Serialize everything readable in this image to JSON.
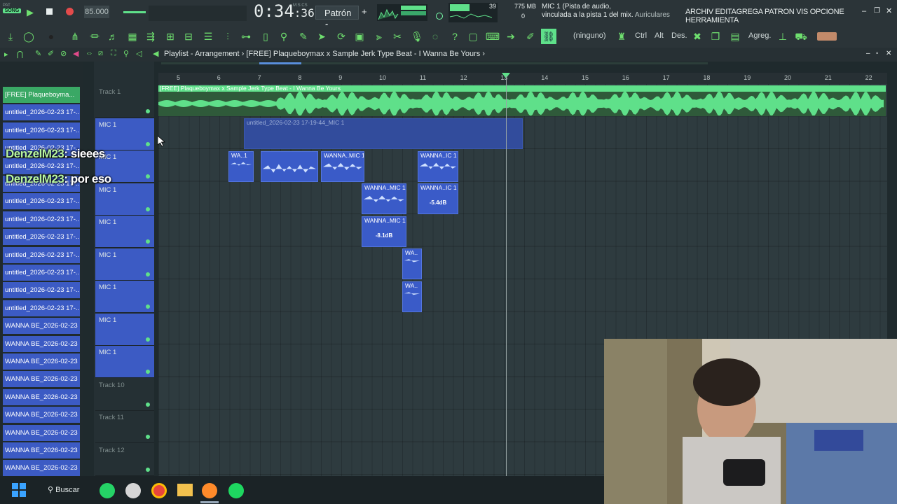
{
  "topbar": {
    "song_label": "SONG",
    "bpm": "85.000",
    "time_main": "0:34",
    "time_sub": ":36",
    "time_unit": "M:S:CS",
    "pattern": "Patrón 1",
    "cpu_value": "39",
    "memory": "775 MB",
    "voice_count": "0",
    "hint_line1": "MIC 1 (Pista de audio,",
    "hint_line2": "vinculada a la pista 1 del mix.",
    "hint_line3": "Auriculares",
    "menu": "ARCHIV EDITAGREGA PATRON VIS OPCIONE HERRAMIENTA"
  },
  "toolbar2": {
    "none_label": "(ninguno)",
    "ctrl": "Ctrl",
    "alt": "Alt",
    "des": "Des.",
    "agreg": "Agreg."
  },
  "playlist": {
    "title": "Playlist - Arrangement",
    "song_name": "[FREE] Plaqueboymax x Sample Jerk Type Beat - I Wanna Be Yours",
    "ruler": [
      "5",
      "6",
      "7",
      "8",
      "9",
      "10",
      "11",
      "12",
      "13",
      "14",
      "15",
      "16",
      "17",
      "18",
      "19",
      "20",
      "21",
      "22"
    ],
    "audio_clip_label": "untitled_2026-02-23 17-19-44_MIC 1",
    "clips": [
      {
        "label": "WA..1"
      },
      {
        "label": ""
      },
      {
        "label": "WANNA..MIC 1"
      },
      {
        "label": "WANNA..IC 1"
      },
      {
        "label": "WANNA..MIC 1"
      },
      {
        "label": "WANNA..IC 1",
        "db": "-5.4dB"
      },
      {
        "label": "WANNA..MIC 1",
        "db": "-8.1dB"
      },
      {
        "label": "WA.."
      },
      {
        "label": "WA.."
      }
    ]
  },
  "browser": {
    "items": [
      "[FREE] Plaqueboyma...",
      "untitled_2026-02-23 17-...",
      "untitled_2026-02-23 17-...",
      "untitled_2026-02-23 17-...",
      "untitled_2026-02-23 17-...",
      "untitled_2026-02-23 17-...",
      "untitled_2026-02-23 17-...",
      "untitled_2026-02-23 17-...",
      "untitled_2026-02-23 17-...",
      "untitled_2026-02-23 17-...",
      "untitled_2026-02-23 17-...",
      "untitled_2026-02-23 17-...",
      "untitled_2026-02-23 17-...",
      "WANNA BE_2026-02-23 1...",
      "WANNA BE_2026-02-23 1...",
      "WANNA BE_2026-02-23 1...",
      "WANNA BE_2026-02-23 1...",
      "WANNA BE_2026-02-23 1...",
      "WANNA BE_2026-02-23 1...",
      "WANNA BE_2026-02-23 1...",
      "WANNA BE_2026-02-23 1...",
      "WANNA BE_2026-02-23 1..."
    ]
  },
  "tracks": [
    {
      "name": "Track 1"
    },
    {
      "name": "MIC 1"
    },
    {
      "name": "MIC 1"
    },
    {
      "name": "MIC 1"
    },
    {
      "name": "MIC 1"
    },
    {
      "name": "MIC 1"
    },
    {
      "name": "MIC 1"
    },
    {
      "name": "MIC 1"
    },
    {
      "name": "MIC 1"
    },
    {
      "name": "Track 10"
    },
    {
      "name": "Track 11"
    },
    {
      "name": "Track 12"
    }
  ],
  "chat": [
    {
      "user": "DenzelM23",
      "message": ": sieees"
    },
    {
      "user": "DenzelM23",
      "message": ": por eso"
    }
  ],
  "taskbar": {
    "search": "Buscar"
  },
  "colors": {
    "accent_green": "#5fe08a",
    "clip_blue": "#3a5bc8",
    "background": "#2e3b3f"
  }
}
